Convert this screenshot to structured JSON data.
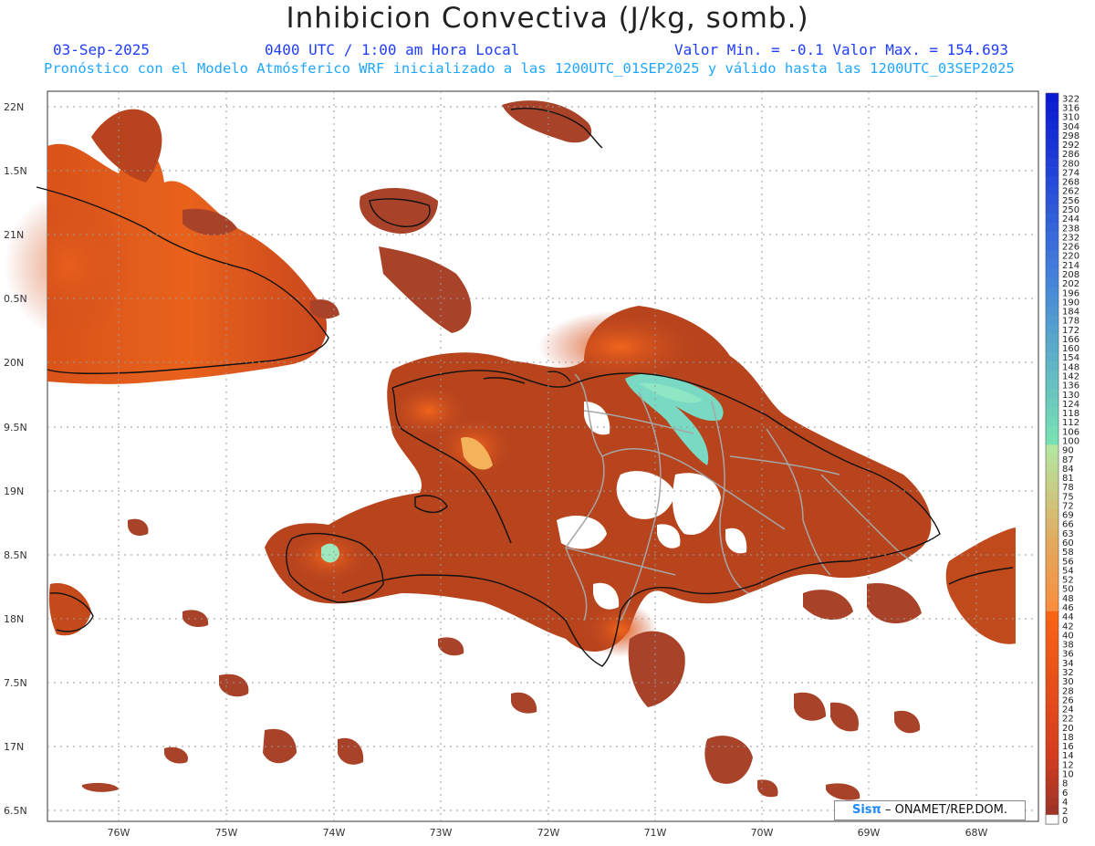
{
  "header": {
    "title": "Inhibicion Convectiva (J/kg, somb.)",
    "date": "03-Sep-2025",
    "time": "0400 UTC / 1:00 am Hora Local",
    "minmax": "Valor Min. = -0.1  Valor Max. = 154.693",
    "model_line": "Pronóstico con el Modelo Atmósferico WRF inicializado a las 1200UTC_01SEP2025 y válido hasta las  1200UTC_03SEP2025"
  },
  "axes": {
    "lat_labels": [
      "22N",
      "1.5N",
      "21N",
      "0.5N",
      "20N",
      "9.5N",
      "19N",
      "8.5N",
      "18N",
      "7.5N",
      "17N",
      "6.5N"
    ],
    "lon_labels": [
      "76W",
      "75W",
      "74W",
      "73W",
      "72W",
      "71W",
      "70W",
      "69W",
      "68W"
    ]
  },
  "legend": {
    "values": [
      "322",
      "316",
      "310",
      "304",
      "298",
      "292",
      "286",
      "280",
      "274",
      "268",
      "262",
      "256",
      "250",
      "244",
      "238",
      "232",
      "226",
      "220",
      "214",
      "208",
      "202",
      "196",
      "190",
      "184",
      "178",
      "172",
      "166",
      "160",
      "154",
      "148",
      "142",
      "136",
      "130",
      "124",
      "118",
      "112",
      "106",
      "100",
      "90",
      "87",
      "84",
      "81",
      "78",
      "75",
      "72",
      "69",
      "66",
      "63",
      "60",
      "58",
      "56",
      "54",
      "52",
      "50",
      "48",
      "46",
      "44",
      "42",
      "40",
      "38",
      "36",
      "34",
      "32",
      "30",
      "28",
      "26",
      "24",
      "22",
      "20",
      "18",
      "16",
      "14",
      "12",
      "10",
      "8",
      "6",
      "4",
      "2",
      "0"
    ]
  },
  "credit": {
    "brand": "Sisπ",
    "text": "– ONAMET/REP.DOM."
  },
  "colors": {
    "field_base": "#a8432a",
    "field_mid": "#c7481c",
    "field_hot": "#ea5a18",
    "field_high": "#7fe0c8",
    "coast": "#111111",
    "provinces": "#a6a6a6",
    "grid": "#9a9a9a",
    "title_blue": "#1f3dff",
    "subtitle_cyan": "#1fa7ff"
  }
}
